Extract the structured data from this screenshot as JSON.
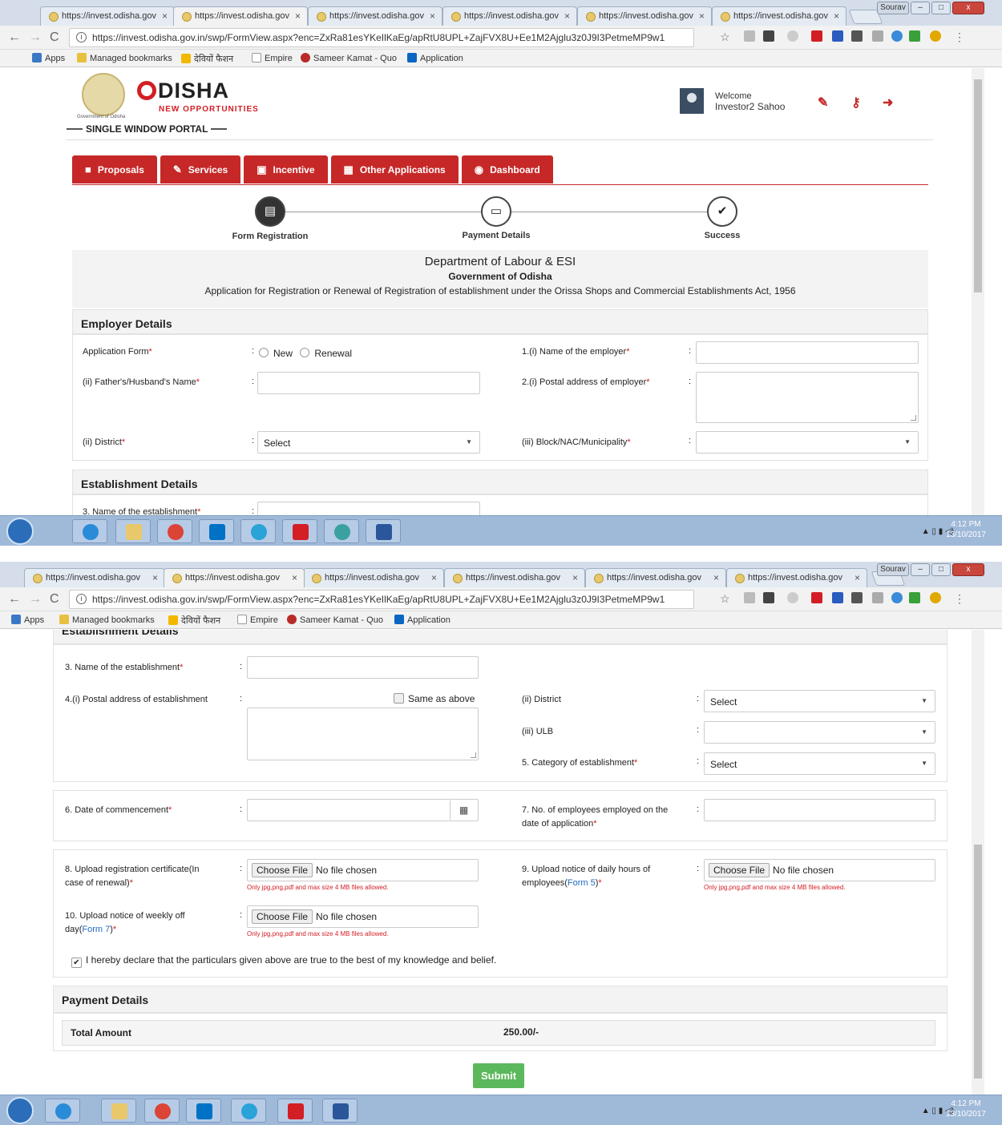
{
  "browser": {
    "tab_titles": [
      "https://invest.odisha.gov",
      "https://invest.odisha.gov",
      "https://invest.odisha.gov",
      "https://invest.odisha.gov",
      "https://invest.odisha.gov",
      "https://invest.odisha.gov"
    ],
    "tab_close": "×",
    "user_button": "Sourav",
    "url": "https://invest.odisha.gov.in/swp/FormView.aspx?enc=ZxRa81esYKeIlKaEg/apRtU8UPL+ZajFVX8U+Ee1M2Ajglu3z0J9I3PetmeMP9w1",
    "bookmarks": {
      "apps": "Apps",
      "managed": "Managed bookmarks",
      "hindi": "देवियों फैशन",
      "empire": "Empire",
      "sameer": "Sameer Kamat - Quo",
      "application": "Application"
    }
  },
  "header": {
    "logo_word": "DISHA",
    "logo_tagline": "NEW OPPORTUNITIES",
    "logo_gov": "Government of Odisha",
    "portal_name": "SINGLE WINDOW PORTAL",
    "welcome": "Welcome",
    "user_name": "Investor2 Sahoo"
  },
  "nav": {
    "tabs": [
      {
        "label": "Proposals",
        "icon": "briefcase-icon"
      },
      {
        "label": "Services",
        "icon": "wrench-icon"
      },
      {
        "label": "Incentive",
        "icon": "money-icon"
      },
      {
        "label": "Other Applications",
        "icon": "grid-icon"
      },
      {
        "label": "Dashboard",
        "icon": "dashboard-icon"
      }
    ]
  },
  "steps": [
    {
      "label": "Form Registration",
      "icon": "document-icon"
    },
    {
      "label": "Payment Details",
      "icon": "card-icon"
    },
    {
      "label": "Success",
      "icon": "check-icon"
    }
  ],
  "department": {
    "title": "Department of Labour & ESI",
    "subtitle": "Government of Odisha",
    "description": "Application for Registration or Renewal of Registration of establishment under the Orissa Shops and Commercial Establishments Act, 1956"
  },
  "employer": {
    "section_title": "Employer Details",
    "application_form_label": "Application Form",
    "option_new": "New",
    "option_renewal": "Renewal",
    "employer_name_label": "1.(i) Name of the employer",
    "father_name_label": "(ii) Father's/Husband's Name",
    "postal_address_label": "2.(i) Postal address of employer",
    "district_label": "(ii) District",
    "district_value": "Select",
    "block_label": "(iii) Block/NAC/Municipality",
    "block_value": ""
  },
  "establishment": {
    "section_title": "Establishment Details",
    "name_label": "3. Name of the establishment",
    "postal_label": "4.(i) Postal address of establishment",
    "same_as_above": "Same as above",
    "district_label": "(ii) District",
    "district_value": "Select",
    "ulb_label": "(iii) ULB",
    "ulb_value": "",
    "category_label": "5. Category of establishment",
    "category_value": "Select",
    "commencement_label": "6. Date of commencement",
    "employees_label_1": "7. No. of employees employed on the",
    "employees_label_2": "date of application",
    "upload_cert_label_1": "8. Upload registration certificate(In",
    "upload_cert_label_2": "case of renewal)",
    "upload_daily_label_1": "9. Upload notice of daily hours of",
    "upload_daily_label_2": "employees(",
    "upload_daily_link": "Form 5",
    "upload_weekly_label_1": "10. Upload notice of weekly off",
    "upload_weekly_label_2": "day(",
    "upload_weekly_link": "Form 7",
    "choose_file": "Choose File",
    "no_file": "No file chosen",
    "file_hint": "Only jpg,png,pdf and max size 4 MB files allowed.",
    "declaration": "I hereby declare that the particulars given above are true to the best of my knowledge and belief."
  },
  "payment": {
    "section_title": "Payment Details",
    "total_label": "Total Amount",
    "total_value": "250.00/-",
    "submit_label": "Submit"
  },
  "common": {
    "colon": ":",
    "required_mark": "*",
    "close_paren": ")"
  },
  "taskbar": {
    "time": "4:12 PM",
    "date": "13/10/2017",
    "apps": [
      "ie-icon",
      "explorer-icon",
      "chrome-icon",
      "outlook-icon",
      "people-icon",
      "acrobat-icon",
      "browser-icon",
      "word-icon"
    ]
  },
  "colors": {
    "brand_red": "#c62828",
    "submit_green": "#5cb85c",
    "required_red": "#d31e25",
    "link_blue": "#1e6ac2"
  }
}
